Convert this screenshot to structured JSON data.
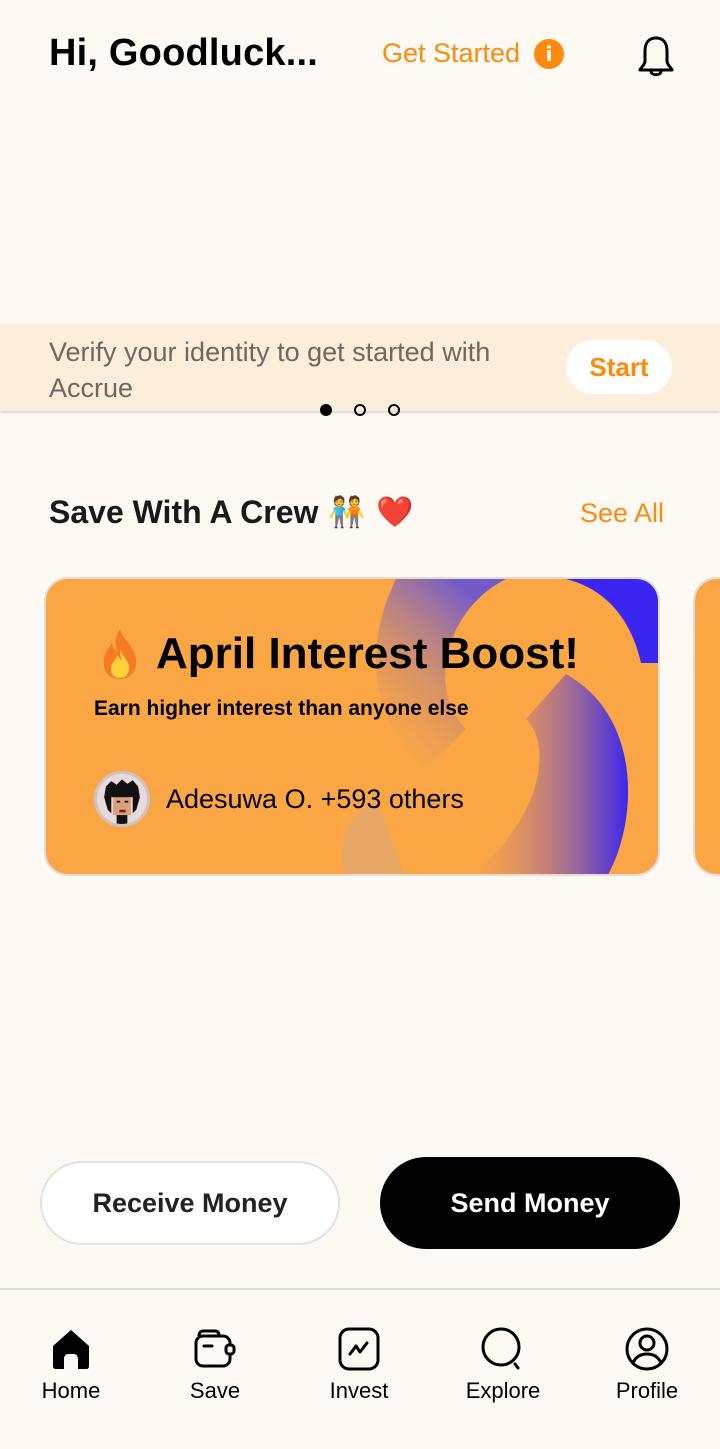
{
  "header": {
    "greeting": "Hi, Goodluck...",
    "get_started_label": "Get Started",
    "info_icon": "i"
  },
  "verify_banner": {
    "text": "Verify your identity to get started with Accrue",
    "button_label": "Start"
  },
  "carousel": {
    "dot_count": 3,
    "active_index": 0
  },
  "crew_section": {
    "title": "Save With A Crew",
    "emoji": "🧑‍🤝‍🧑 ❤️",
    "see_all_label": "See All"
  },
  "crew_card": {
    "title": "April Interest Boost!",
    "subtitle": "Earn higher interest than anyone else",
    "members_text": "Adesuwa O. +593 others"
  },
  "actions": {
    "receive_label": "Receive Money",
    "send_label": "Send Money"
  },
  "bottom_nav": {
    "items": [
      {
        "label": "Home",
        "icon": "home-icon",
        "active": true
      },
      {
        "label": "Save",
        "icon": "wallet-icon"
      },
      {
        "label": "Invest",
        "icon": "chart-icon"
      },
      {
        "label": "Explore",
        "icon": "search-icon"
      },
      {
        "label": "Profile",
        "icon": "user-icon"
      }
    ]
  },
  "colors": {
    "accent": "#fb8a0f",
    "background": "#fef9f3",
    "banner": "#fdeedb",
    "card": "#fba645",
    "card_deco": "#3a26f0"
  }
}
